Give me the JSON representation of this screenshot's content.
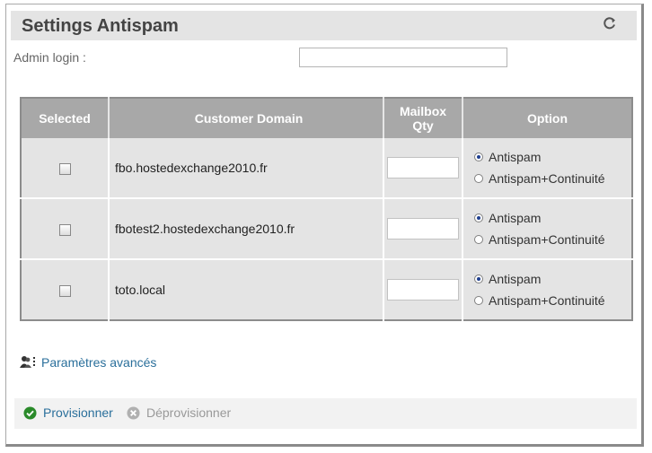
{
  "header": {
    "title": "Settings Antispam",
    "refresh_icon": "refresh-icon"
  },
  "admin": {
    "label": "Admin login :",
    "value": ""
  },
  "table": {
    "headers": {
      "selected": "Selected",
      "domain": "Customer Domain",
      "qty": "Mailbox\nQty",
      "option": "Option"
    },
    "rows": [
      {
        "checked": false,
        "domain": "fbo.hostedexchange2010.fr",
        "qty": "",
        "options": [
          {
            "label": "Antispam",
            "selected": true
          },
          {
            "label": "Antispam+Continuité",
            "selected": false
          }
        ]
      },
      {
        "checked": false,
        "domain": "fbotest2.hostedexchange2010.fr",
        "qty": "",
        "options": [
          {
            "label": "Antispam",
            "selected": true
          },
          {
            "label": "Antispam+Continuité",
            "selected": false
          }
        ]
      },
      {
        "checked": false,
        "domain": "toto.local",
        "qty": "",
        "options": [
          {
            "label": "Antispam",
            "selected": true
          },
          {
            "label": "Antispam+Continuité",
            "selected": false
          }
        ]
      }
    ]
  },
  "advanced": {
    "icon": "users-settings-icon",
    "label": "Paramètres avancés"
  },
  "footer": {
    "provision": {
      "icon": "check-circle-icon",
      "label": "Provisionner",
      "color": "#2a8a2a"
    },
    "deprovision": {
      "icon": "x-circle-icon",
      "label": "Déprovisionner",
      "color": "#b0b0b0"
    }
  }
}
